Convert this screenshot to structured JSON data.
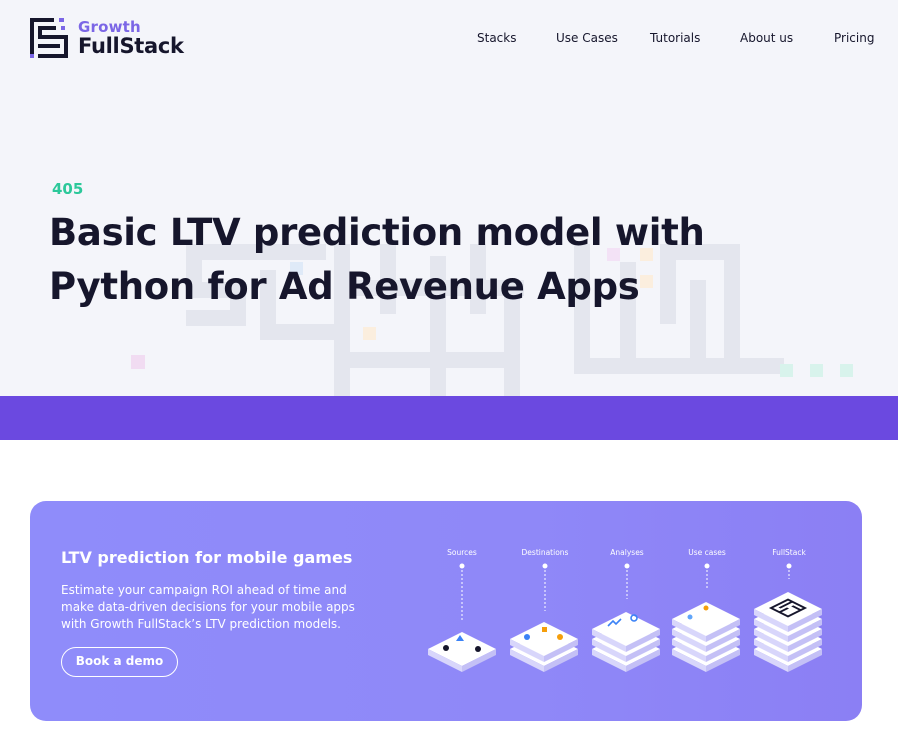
{
  "brand": {
    "growth": "Growth",
    "fullstack": "FullStack"
  },
  "nav": [
    {
      "label": "Stacks",
      "name": "nav-stacks"
    },
    {
      "label": "Use Cases",
      "name": "nav-use-cases"
    },
    {
      "label": "Tutorials",
      "name": "nav-tutorials"
    },
    {
      "label": "About us",
      "name": "nav-about-us"
    },
    {
      "label": "Pricing",
      "name": "nav-pricing"
    }
  ],
  "article": {
    "number": "405",
    "title_line1": "Basic LTV prediction model with",
    "title_line2": "Python for Ad Revenue Apps"
  },
  "colors": {
    "accent_purple": "#6b49e0",
    "accent_green": "#2cc89a",
    "brand_purple": "#7b66e6",
    "promo_bg": "#8f8cfa"
  },
  "promo": {
    "title": "LTV prediction for mobile games",
    "description": "Estimate your campaign ROI ahead of time and make data-driven decisions for your mobile apps with Growth FullStack’s LTV prediction models.",
    "button_label": "Book a demo",
    "stages": [
      "Sources",
      "Destinations",
      "Analyses",
      "Use cases",
      "FullStack"
    ]
  }
}
